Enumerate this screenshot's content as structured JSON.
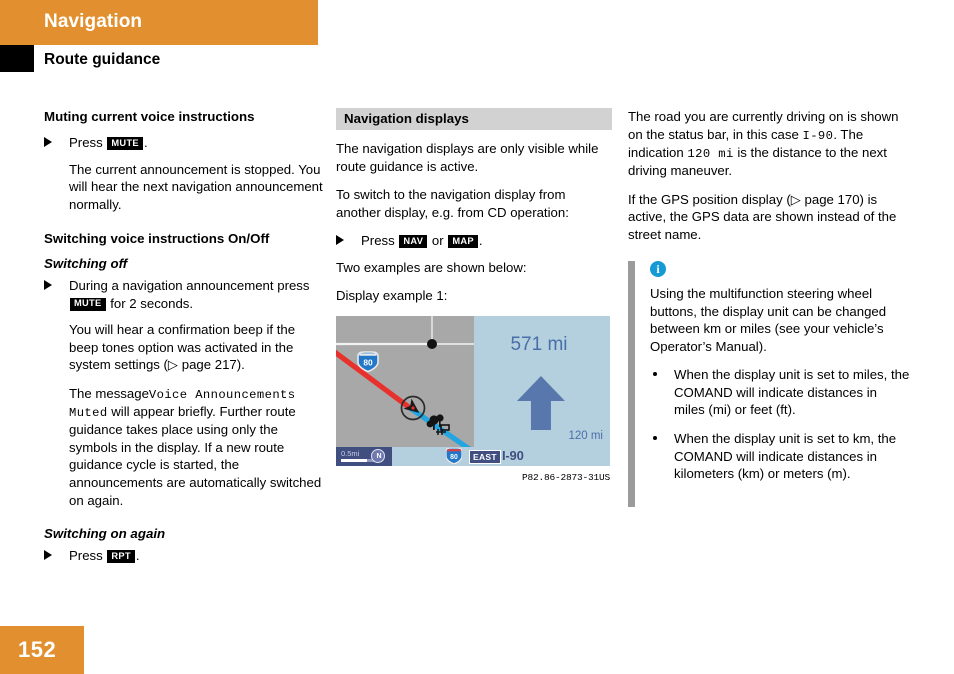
{
  "header": {
    "section_title": "Navigation",
    "chapter_title": "Route guidance",
    "accent_color": "#e2902f"
  },
  "footer": {
    "page_number": "152"
  },
  "left_column": {
    "heading_1": "Muting current voice instructions",
    "step_1_prefix": "Press",
    "step_1_key": "MUTE",
    "step_1_suffix": ".",
    "para_1": "The current announcement is stopped. You will hear the next navigation announcement normally.",
    "heading_2": "Switching voice instructions On/Off",
    "subheading_1": "Switching off",
    "step_2_line1": "During a navigation announcement",
    "step_2_prefix": "press",
    "step_2_key": "MUTE",
    "step_2_suffix": "for 2 seconds.",
    "para_2": "You will hear a confirmation beep if the beep tones option was activated in the system settings (▷ page 217).",
    "para_3_lead": "The message",
    "para_3_mono": "Voice Announcements Muted",
    "para_3_rest": "will appear briefly. Further route guidance takes place using only the symbols in the display. If a new route guidance cycle is started, the announcements are automatically switched on again.",
    "subheading_2": "Switching on again",
    "step_3_prefix": "Press",
    "step_3_key": "RPT",
    "step_3_suffix": "."
  },
  "mid_column": {
    "section_header": "Navigation displays",
    "para_1": "The navigation displays are only visible while route guidance is active.",
    "para_2": "To switch to the navigation display from another display, e.g. from CD operation:",
    "step_prefix": "Press",
    "step_key_1": "NAV",
    "step_conjunction": "or",
    "step_key_2": "MAP",
    "step_suffix": ".",
    "para_3": "Two examples are shown below:",
    "para_4": "Display example 1:",
    "figure": {
      "distance_total": "571 mi",
      "distance_next": "120 mi",
      "scale_label": "0.5mi",
      "compass_letter": "N",
      "route_shield_number": "80",
      "status_shield_number": "80",
      "direction_badge": "EAST",
      "road_name": "I-90",
      "caption": "P82.86-2873-31US",
      "map_bg_color": "#a8a8a8",
      "guide_bg_color": "#b4d0de",
      "status_bar_color": "#414e80",
      "arrow_color": "#5878ad",
      "route_done_color": "#e8312c",
      "route_ahead_color": "#22a5e0"
    }
  },
  "right_column": {
    "para_1_a": "The road you are currently driving on is shown on the status bar, in this case",
    "para_1_mono_1": "I-90",
    "para_1_b": ". The indication",
    "para_1_mono_2": "120 mi",
    "para_1_c": "is the distance to the next driving maneuver.",
    "para_2": "If the GPS position display (▷ page 170) is active, the GPS data are shown instead of the street name.",
    "note": {
      "icon": "info-icon",
      "icon_glyph": "i",
      "icon_color": "#159ad6",
      "text": "Using the multifunction steering wheel buttons, the display unit can be changed between km or miles (see your vehicle’s Operator’s Manual).",
      "bullets": [
        "When the display unit is set to miles, the COMAND will indicate distances in miles (mi) or feet (ft).",
        "When the display unit is set to km, the COMAND will indicate distances in kilometers (km) or meters (m)."
      ]
    }
  }
}
